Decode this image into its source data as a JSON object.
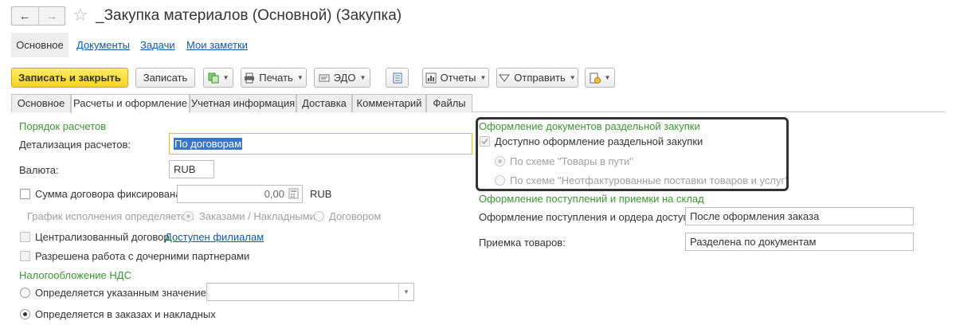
{
  "window": {
    "title": "_Закупка материалов (Основной) (Закупка)"
  },
  "sections": {
    "main": "Основное",
    "documents": "Документы",
    "tasks": "Задачи",
    "notes": "Мои заметки"
  },
  "toolbar": {
    "save_close": "Записать и закрыть",
    "save": "Записать",
    "print": "Печать",
    "edo": "ЭДО",
    "reports": "Отчеты",
    "send": "Отправить"
  },
  "tabs": [
    "Основное",
    "Расчеты и оформление",
    "Учетная информация",
    "Доставка",
    "Комментарий",
    "Файлы"
  ],
  "payment": {
    "group_title": "Порядок расчетов",
    "detail_label": "Детализация расчетов:",
    "detail_value": "По договорам",
    "currency_label": "Валюта:",
    "currency_value": "RUB",
    "fixed_sum_label": "Сумма договора фиксирована",
    "fixed_sum_value": "0,00",
    "fixed_sum_currency": "RUB",
    "schedule_label": "График исполнения определяется:",
    "schedule_opt1": "Заказами / Накладными",
    "schedule_opt2": "Договором",
    "centralized_label": "Централизованный договор",
    "centralized_link": "Доступен филиалам",
    "subsidiaries_label": "Разрешена работа с дочерними партнерами"
  },
  "vat": {
    "group_title": "Налогообложение НДС",
    "opt1": "Определяется указанным значением",
    "opt2": "Определяется в заказах и накладных"
  },
  "separate": {
    "group_title": "Оформление документов раздельной закупки",
    "available_label": "Доступно оформление раздельной закупки",
    "scheme1": "По схеме \"Товары в пути\"",
    "scheme2": "По схеме \"Неотфактурованные поставки товаров и услуг\""
  },
  "receipt": {
    "group_title": "Оформление поступлений и приемки на склад",
    "orders_label": "Оформление поступления и ордера доступно:",
    "orders_value": "После оформления заказа",
    "acceptance_label": "Приемка товаров:",
    "acceptance_value": "Разделена по документам"
  },
  "colors": {
    "primary_button": "#f6d421",
    "group_title": "#3d9435",
    "link": "#0b5ba0"
  }
}
